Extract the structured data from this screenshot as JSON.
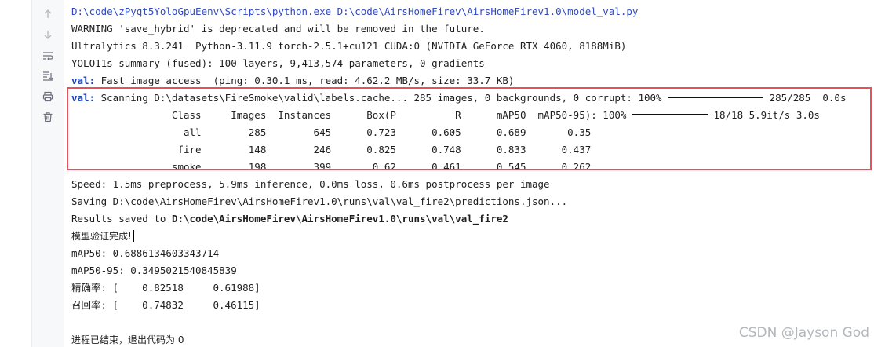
{
  "toolbar": {
    "up_icon": "arrow-up-icon",
    "down_icon": "arrow-down-icon",
    "wrap_icon": "soft-wrap-icon",
    "scroll_end_icon": "scroll-to-end-icon",
    "print_icon": "print-icon",
    "delete_icon": "trash-icon"
  },
  "console": {
    "cmd_line": "D:\\code\\zPyqt5YoloGpuEenv\\Scripts\\python.exe D:\\code\\AirsHomeFirev\\AirsHomeFirev1.0\\model_val.py",
    "warning_line": "WARNING 'save_hybrid' is deprecated and will be removed in the future.",
    "env_line": "Ultralytics 8.3.241  Python-3.11.9 torch-2.5.1+cu121 CUDA:0 (NVIDIA GeForce RTX 4060, 8188MiB)",
    "summary_line": "YOLO11s summary (fused): 100 layers, 9,413,574 parameters, 0 gradients",
    "val_prefix": "val:",
    "fast_access": " Fast image access  (ping: 0.30.1 ms, read: 4.62.2 MB/s, size: 33.7 KB)",
    "scan_text": " Scanning D:\\datasets\\FireSmoke\\valid\\labels.cache... 285 images, 0 backgrounds, 0 corrupt: 100%",
    "scan_progress": 1.0,
    "scan_tail": " 285/285  0.0s",
    "header_text": "                 Class     Images  Instances      Box(P          R      mAP50  mAP50-95): 100%",
    "header_progress": 1.0,
    "header_tail": " 18/18 5.9it/s 3.0s",
    "rows": [
      {
        "text": "                   all        285        645      0.723      0.605      0.689       0.35"
      },
      {
        "text": "                  fire        148        246      0.825      0.748      0.833      0.437"
      },
      {
        "text": "                 smoke        198        399       0.62      0.461      0.545      0.262"
      }
    ],
    "speed_line": "Speed: 1.5ms preprocess, 5.9ms inference, 0.0ms loss, 0.6ms postprocess per image",
    "saving_line": "Saving D:\\code\\AirsHomeFirev\\AirsHomeFirev1.0\\runs\\val\\val_fire2\\predictions.json...",
    "results_prefix": "Results saved to ",
    "results_path": "D:\\code\\AirsHomeFirev\\AirsHomeFirev1.0\\runs\\val\\val_fire2",
    "done_line": "模型验证完成!",
    "map50_line": "mAP50: 0.6886134603343714",
    "map5095_line": "mAP50-95: 0.3495021540845839",
    "precision_line": "精确率: [    0.82518     0.61988]",
    "recall_line": "召回率: [    0.74832     0.46115]",
    "exit_line": "进程已结束，退出代码为 0"
  },
  "watermark": "CSDN @Jayson God",
  "colors": {
    "highlight_border": "#e8505b",
    "path_blue": "#2f4bbf",
    "gutter_bg": "#f7f8fa"
  }
}
